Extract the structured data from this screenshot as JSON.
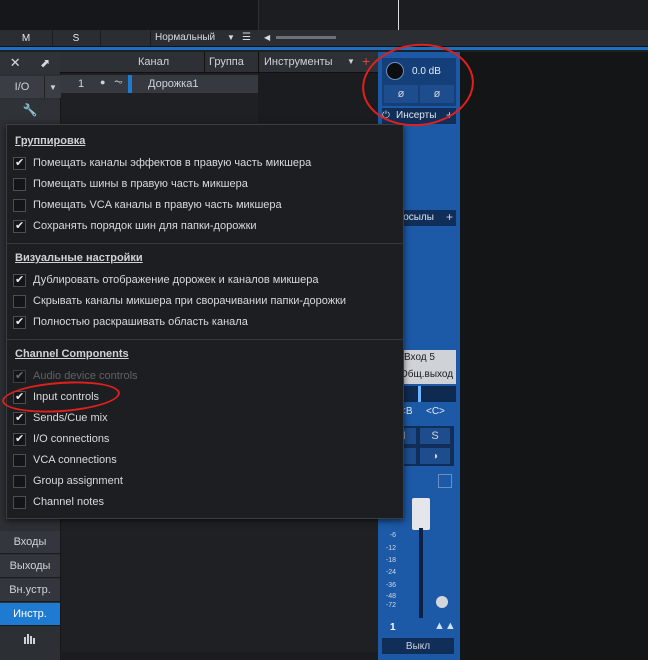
{
  "transport": {
    "m_label": "M",
    "s_label": "S",
    "mode_value": "Нормальный"
  },
  "track_header": {
    "channel_col": "Канал",
    "group_col": "Группа",
    "instruments_label": "Инструменты"
  },
  "left_panel": {
    "io_label": "I/O",
    "buttons": [
      "Входы",
      "Выходы",
      "Вн.устр.",
      "Инстр."
    ]
  },
  "track": {
    "number": "1",
    "name": "Дорожка1"
  },
  "mixer": {
    "volume": "0.0 dB",
    "phase_symbol": "ø",
    "inserts_label": "Инсерты",
    "sends_label": "Посылы",
    "input_label": "Вход 5",
    "output_label": "Общ.выход",
    "pan_left": "<B",
    "pan_center": "<C>",
    "mute": "M",
    "solo": "S",
    "scale": [
      "-6",
      "-12",
      "-18",
      "-24",
      "-36",
      "-48",
      "-72"
    ],
    "channel_number": "1",
    "bottom_label": "Выкл"
  },
  "menu": {
    "sections": [
      {
        "title": "Группировка",
        "items": [
          {
            "label": "Помещать каналы эффектов в правую часть микшера",
            "checked": true,
            "enabled": true
          },
          {
            "label": "Помещать шины в правую часть микшера",
            "checked": false,
            "enabled": true
          },
          {
            "label": "Помещать VCA каналы в правую часть микшера",
            "checked": false,
            "enabled": true
          },
          {
            "label": "Сохранять порядок шин для папки-дорожки",
            "checked": true,
            "enabled": true
          }
        ]
      },
      {
        "title": "Визуальные настройки",
        "items": [
          {
            "label": "Дублировать отображение дорожек и каналов микшера",
            "checked": true,
            "enabled": true
          },
          {
            "label": "Скрывать каналы микшера при сворачивании папки-дорожки",
            "checked": false,
            "enabled": true
          },
          {
            "label": "Полностью раскрашивать область канала",
            "checked": true,
            "enabled": true
          }
        ]
      },
      {
        "title": "Channel Components",
        "items": [
          {
            "label": "Audio device controls",
            "checked": true,
            "enabled": false
          },
          {
            "label": "Input controls",
            "checked": true,
            "enabled": true
          },
          {
            "label": "Sends/Cue mix",
            "checked": true,
            "enabled": true
          },
          {
            "label": "I/O connections",
            "checked": true,
            "enabled": true
          },
          {
            "label": "VCA connections",
            "checked": false,
            "enabled": true
          },
          {
            "label": "Group assignment",
            "checked": false,
            "enabled": true
          },
          {
            "label": "Channel notes",
            "checked": false,
            "enabled": true
          }
        ]
      }
    ]
  },
  "colors": {
    "accent": "#1e7bd1",
    "annotation": "#e0201c",
    "mixer_blue": "#1c59a6"
  }
}
